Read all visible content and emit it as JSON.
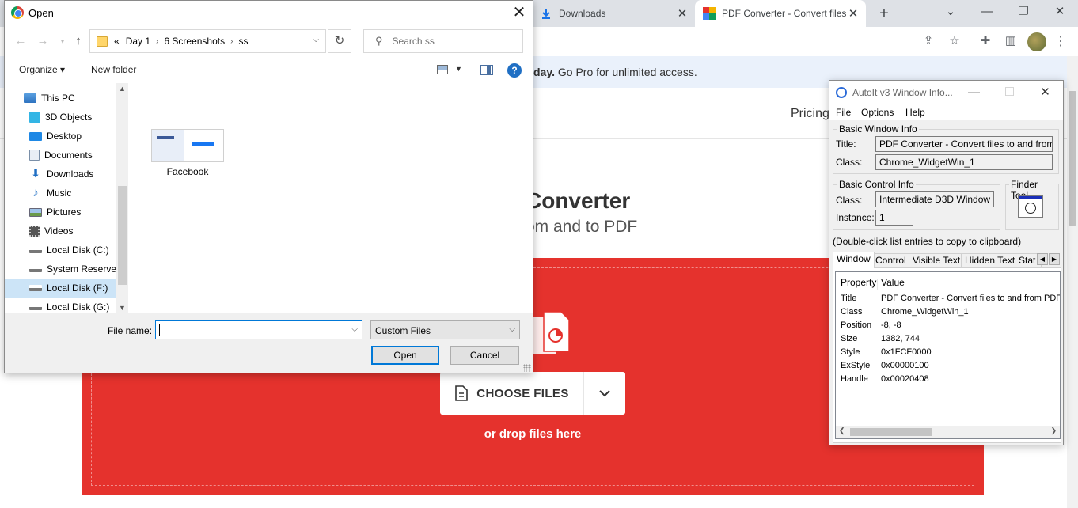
{
  "browser": {
    "tabs": [
      {
        "label": "Downloads"
      },
      {
        "label": "PDF Converter - Convert files"
      }
    ],
    "new_tab": "+",
    "window_controls": {
      "minimize": "—",
      "restore": "❐",
      "close": "✕"
    },
    "tab_search": "⌄"
  },
  "page": {
    "banner_bold": "day.",
    "banner_text": " Go Pro for unlimited access.",
    "nav_pricing": "Pricing",
    "heading": "Converter",
    "subheading": "om and to PDF",
    "choose_files": "CHOOSE FILES",
    "drop_text": "or drop files here",
    "accent_color": "#e5322d"
  },
  "open_dialog": {
    "title": "Open",
    "close_glyph": "✕",
    "breadcrumb": [
      "Day 1",
      "6 Screenshots",
      "ss"
    ],
    "breadcrumb_prefix": "«",
    "search_placeholder": "Search ss",
    "organize": "Organize ▾",
    "new_folder": "New folder",
    "help": "?",
    "tree": [
      {
        "label": "This PC",
        "icon": "pc-icon"
      },
      {
        "label": "3D Objects",
        "icon": "cube-icon"
      },
      {
        "label": "Desktop",
        "icon": "desktop-icon"
      },
      {
        "label": "Documents",
        "icon": "documents-icon"
      },
      {
        "label": "Downloads",
        "icon": "download-icon"
      },
      {
        "label": "Music",
        "icon": "music-icon"
      },
      {
        "label": "Pictures",
        "icon": "pictures-icon"
      },
      {
        "label": "Videos",
        "icon": "videos-icon"
      },
      {
        "label": "Local Disk (C:)",
        "icon": "drive-icon"
      },
      {
        "label": "System Reservec",
        "icon": "drive-icon"
      },
      {
        "label": "Local Disk (F:)",
        "icon": "drive-icon",
        "selected": true
      },
      {
        "label": "Local Disk (G:)",
        "icon": "drive-icon"
      }
    ],
    "files": [
      {
        "name": "Facebook"
      }
    ],
    "file_name_label": "File name:",
    "file_name_value": "",
    "file_type": "Custom Files",
    "open_button": "Open",
    "cancel_button": "Cancel"
  },
  "autoit": {
    "title": "AutoIt v3 Window Info...",
    "menu": [
      "File",
      "Options",
      "Help"
    ],
    "basic_window_info": "Basic Window Info",
    "title_label": "Title:",
    "title_value": "PDF Converter - Convert files to and from PDFs",
    "class_label": "Class:",
    "class_value": "Chrome_WidgetWin_1",
    "basic_control_info": "Basic Control Info",
    "control_class_label": "Class:",
    "control_class_value": "Intermediate D3D Window",
    "instance_label": "Instance:",
    "instance_value": "1",
    "finder_tool": "Finder Tool",
    "hint": "(Double-click list entries to copy to clipboard)",
    "tabs": [
      "Window",
      "Control",
      "Visible Text",
      "Hidden Text",
      "Stat"
    ],
    "list_headers": {
      "property": "Property",
      "value": "Value"
    },
    "rows": [
      {
        "property": "Title",
        "value": "PDF Converter - Convert files to and from PDFs"
      },
      {
        "property": "Class",
        "value": "Chrome_WidgetWin_1"
      },
      {
        "property": "Position",
        "value": "-8, -8"
      },
      {
        "property": "Size",
        "value": "1382, 744"
      },
      {
        "property": "Style",
        "value": "0x1FCF0000"
      },
      {
        "property": "ExStyle",
        "value": "0x00000100"
      },
      {
        "property": "Handle",
        "value": "0x00020408"
      }
    ]
  }
}
